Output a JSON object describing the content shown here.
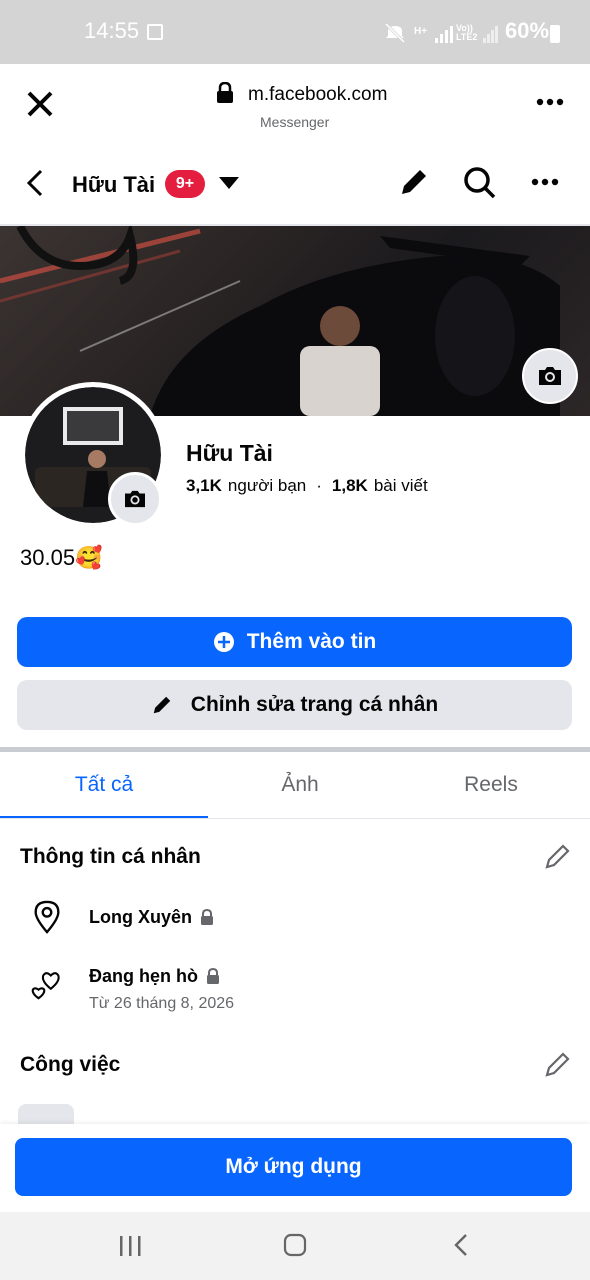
{
  "status": {
    "time": "14:55",
    "net1": "H+",
    "net2": "Vo)) LTE2",
    "battery": "60%"
  },
  "browser": {
    "url": "m.facebook.com",
    "subtitle": "Messenger"
  },
  "header": {
    "name": "Hữu Tài",
    "badge": "9+"
  },
  "profile": {
    "name": "Hữu Tài",
    "friends_count": "3,1K",
    "friends_label": "người bạn",
    "separator": "·",
    "posts_count": "1,8K",
    "posts_label": "bài viết",
    "bio": "30.05🥰"
  },
  "actions": {
    "add_story": "Thêm vào tin",
    "edit_profile": "Chỉnh sửa trang cá nhân"
  },
  "tabs": [
    {
      "label": "Tất cả"
    },
    {
      "label": "Ảnh"
    },
    {
      "label": "Reels"
    }
  ],
  "info": {
    "title": "Thông tin cá nhân",
    "location": "Long Xuyên",
    "relationship": "Đang hẹn hò",
    "relationship_since": "Từ 26 tháng 8, 2026"
  },
  "work": {
    "title": "Công việc"
  },
  "open_app": "Mở ứng dụng",
  "colors": {
    "brand": "#0866ff",
    "badge": "#e41e3f",
    "tab_active": "#0866ff"
  }
}
